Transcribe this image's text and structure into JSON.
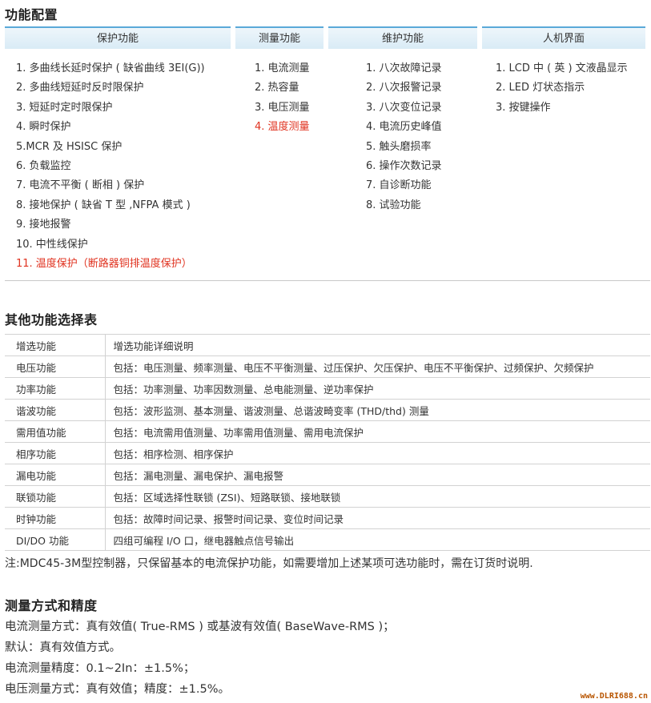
{
  "sections": {
    "functions_title": "功能配置",
    "optional_title": "其他功能选择表",
    "measure_title": "测量方式和精度"
  },
  "feature_table": {
    "headers": [
      "保护功能",
      "测量功能",
      "维护功能",
      "人机界面"
    ],
    "protection": [
      "1. 多曲线长延时保护 ( 缺省曲线 3EI(G))",
      "2. 多曲线短延时反时限保护",
      "3. 短延时定时限保护",
      "4. 瞬时保护",
      "5.MCR 及 HSISC 保护",
      "6. 负载监控",
      "7. 电流不平衡 ( 断相 ) 保护",
      "8. 接地保护 ( 缺省 T 型 ,NFPA 模式 )",
      "9. 接地报警",
      "10. 中性线保护",
      "11. 温度保护（断路器铜排温度保护）"
    ],
    "measurement": [
      "1. 电流测量",
      "2. 热容量",
      "3. 电压测量",
      "4. 温度测量"
    ],
    "maintenance": [
      "1. 八次故障记录",
      "2. 八次报警记录",
      "3. 八次变位记录",
      "4. 电流历史峰值",
      "5. 触头磨损率",
      "6. 操作次数记录",
      "7. 自诊断功能",
      "8. 试验功能"
    ],
    "hmi": [
      "1. LCD 中 ( 英 ) 文液晶显示",
      "2. LED 灯状态指示",
      "3. 按键操作"
    ],
    "highlight_color": "#e0321f"
  },
  "optional_table": {
    "rows": [
      [
        "增选功能",
        "增选功能详细说明"
      ],
      [
        "电压功能",
        "包括：电压测量、频率测量、电压不平衡测量、过压保护、欠压保护、电压不平衡保护、过频保护、欠频保护"
      ],
      [
        "功率功能",
        "包括：功率测量、功率因数测量、总电能测量、逆功率保护"
      ],
      [
        "谐波功能",
        "包括：波形监测、基本测量、谐波测量、总谐波畸变率 (THD/thd) 测量"
      ],
      [
        "需用值功能",
        "包括：电流需用值测量、功率需用值测量、需用电流保护"
      ],
      [
        "相序功能",
        "包括：相序检测、相序保护"
      ],
      [
        "漏电功能",
        "包括：漏电测量、漏电保护、漏电报警"
      ],
      [
        "联锁功能",
        "包括：区域选择性联锁 (ZSI)、短路联锁、接地联锁"
      ],
      [
        "时钟功能",
        "包括：故障时间记录、报警时间记录、变位时间记录"
      ],
      [
        "DI/DO 功能",
        "四组可编程 I/O 口，继电器触点信号输出"
      ]
    ]
  },
  "note": "注:MDC45-3M型控制器，只保留基本的电流保护功能，如需要增加上述某项可选功能时，需在订货时说明.",
  "measure": {
    "lines": [
      "电流测量方式：真有效值( True-RMS ) 或基波有效值( BaseWave-RMS )；",
      "默认：真有效值方式。",
      "电流测量精度：0.1~2In：±1.5%；",
      "电压测量方式：真有效值；精度：±1.5%。"
    ]
  },
  "watermark": "www.DLRI688.cn",
  "colors": {
    "header_border": "#5aa9d8",
    "header_bg": "#d9ebf6",
    "text": "#333333",
    "watermark": "#b85500"
  }
}
